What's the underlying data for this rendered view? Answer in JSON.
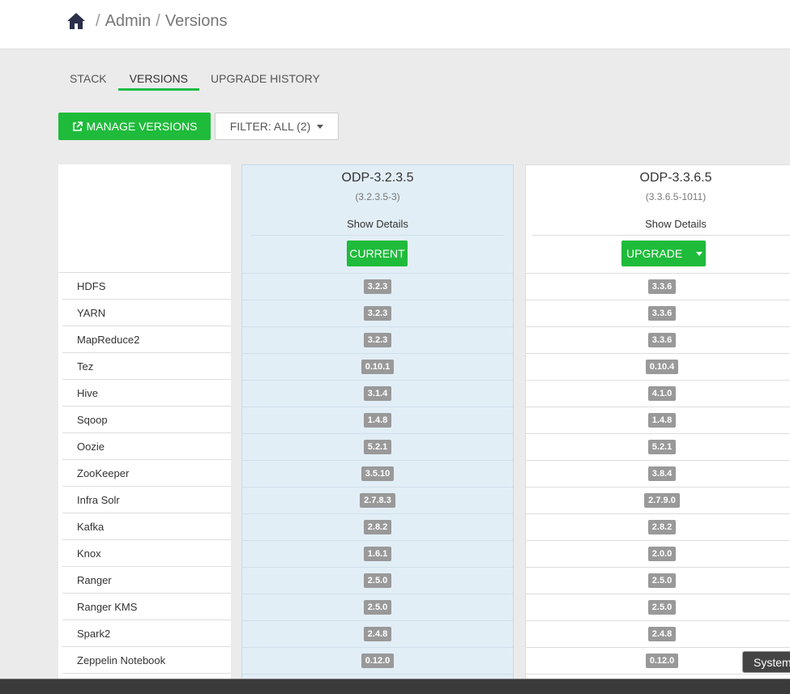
{
  "breadcrumb": {
    "home_icon": "home-icon",
    "items": [
      "Admin",
      "Versions"
    ]
  },
  "tabs": [
    {
      "label": "STACK",
      "active": false
    },
    {
      "label": "VERSIONS",
      "active": true
    },
    {
      "label": "UPGRADE HISTORY",
      "active": false
    }
  ],
  "toolbar": {
    "manage_label": "MANAGE VERSIONS",
    "manage_icon": "external-link-icon",
    "filter_label": "FILTER: ALL (2)"
  },
  "services": [
    "HDFS",
    "YARN",
    "MapReduce2",
    "Tez",
    "Hive",
    "Sqoop",
    "Oozie",
    "ZooKeeper",
    "Infra Solr",
    "Kafka",
    "Knox",
    "Ranger",
    "Ranger KMS",
    "Spark2",
    "Zeppelin Notebook"
  ],
  "versions": [
    {
      "name": "ODP-3.2.3.5",
      "full": "(3.2.3.5-3)",
      "show_details": "Show Details",
      "action": "CURRENT",
      "values": [
        "3.2.3",
        "3.2.3",
        "3.2.3",
        "0.10.1",
        "3.1.4",
        "1.4.8",
        "5.2.1",
        "3.5.10",
        "2.7.8.3",
        "2.8.2",
        "1.6.1",
        "2.5.0",
        "2.5.0",
        "2.4.8",
        "0.12.0"
      ]
    },
    {
      "name": "ODP-3.3.6.5",
      "full": "(3.3.6.5-1011)",
      "show_details": "Show Details",
      "action": "UPGRADE",
      "values": [
        "3.3.6",
        "3.3.6",
        "3.3.6",
        "0.10.4",
        "4.1.0",
        "1.4.8",
        "5.2.1",
        "3.8.4",
        "2.7.9.0",
        "2.8.2",
        "2.0.0",
        "2.5.0",
        "2.5.0",
        "2.4.8",
        "0.12.0"
      ]
    }
  ],
  "status_toast": "System",
  "colors": {
    "accent": "#1fbb3b",
    "current_bg": "#e2eef6",
    "badge": "#999999"
  }
}
